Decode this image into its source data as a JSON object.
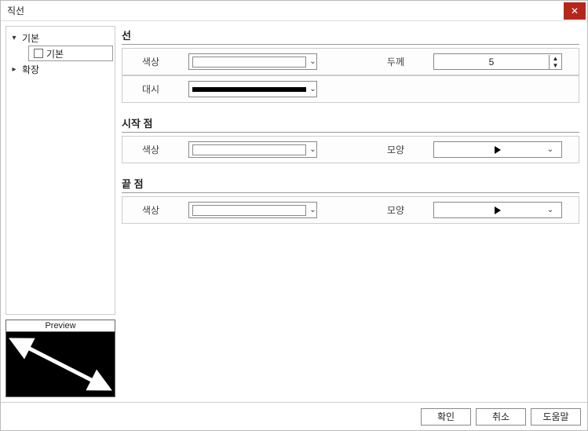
{
  "window": {
    "title": "직선"
  },
  "tree": {
    "root": {
      "label": "기본",
      "child_label": "기본"
    },
    "ext": {
      "label": "확장"
    }
  },
  "preview": {
    "title": "Preview"
  },
  "sections": {
    "line": {
      "title": "선",
      "color_label": "색상",
      "dash_label": "대시",
      "thickness_label": "두께",
      "thickness_value": "5"
    },
    "start": {
      "title": "시작 점",
      "color_label": "색상",
      "shape_label": "모양"
    },
    "end": {
      "title": "끝 점",
      "color_label": "색상",
      "shape_label": "모양"
    }
  },
  "footer": {
    "ok": "확인",
    "cancel": "취소",
    "help": "도움말"
  }
}
